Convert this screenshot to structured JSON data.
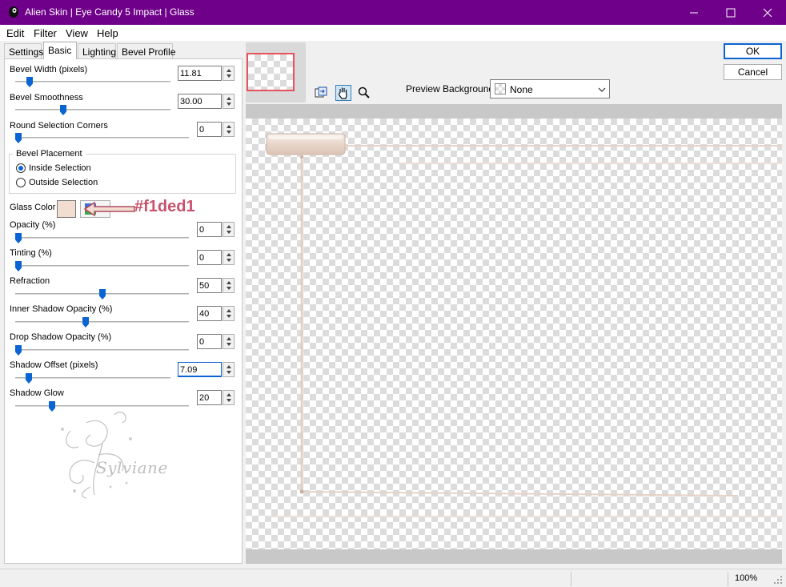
{
  "window": {
    "title": "Alien Skin | Eye Candy 5 Impact | Glass",
    "titlebar_color": "#6f0089"
  },
  "menu": [
    "Edit",
    "Filter",
    "View",
    "Help"
  ],
  "tabs": [
    "Settings",
    "Basic",
    "Lighting",
    "Bevel Profile"
  ],
  "active_tab": "Basic",
  "controls": {
    "bevel_width": {
      "label": "Bevel Width (pixels)",
      "value": "11.81"
    },
    "bevel_smoothness": {
      "label": "Bevel Smoothness",
      "value": "30.00"
    },
    "round_corners": {
      "label": "Round Selection Corners",
      "value": "0"
    },
    "bevel_placement": {
      "title": "Bevel Placement",
      "inside": "Inside Selection",
      "outside": "Outside Selection",
      "selected": "inside"
    },
    "glass_color": {
      "label": "Glass Color",
      "color": "#f1ded1"
    },
    "opacity": {
      "label": "Opacity (%)",
      "value": "0"
    },
    "tinting": {
      "label": "Tinting (%)",
      "value": "0"
    },
    "refraction": {
      "label": "Refraction",
      "value": "50"
    },
    "inner_shadow_opacity": {
      "label": "Inner Shadow Opacity (%)",
      "value": "40"
    },
    "drop_shadow_opacity": {
      "label": "Drop Shadow Opacity (%)",
      "value": "0"
    },
    "shadow_offset": {
      "label": "Shadow Offset (pixels)",
      "value": "7.09"
    },
    "shadow_glow": {
      "label": "Shadow Glow",
      "value": "20"
    }
  },
  "annotation": {
    "text": "#f1ded1",
    "color": "#c9526c"
  },
  "watermark": {
    "text": "Sylviane"
  },
  "buttons": {
    "ok": "OK",
    "cancel": "Cancel"
  },
  "preview": {
    "background_label": "Preview Background:",
    "background_value": "None"
  },
  "status": {
    "zoom": "100%"
  },
  "icons": [
    "app-icon",
    "minimize-icon",
    "maximize-icon",
    "close-icon",
    "navigate-icon",
    "hand-icon",
    "zoom-icon",
    "dropdown-chevron-icon",
    "color-picker-icon"
  ]
}
